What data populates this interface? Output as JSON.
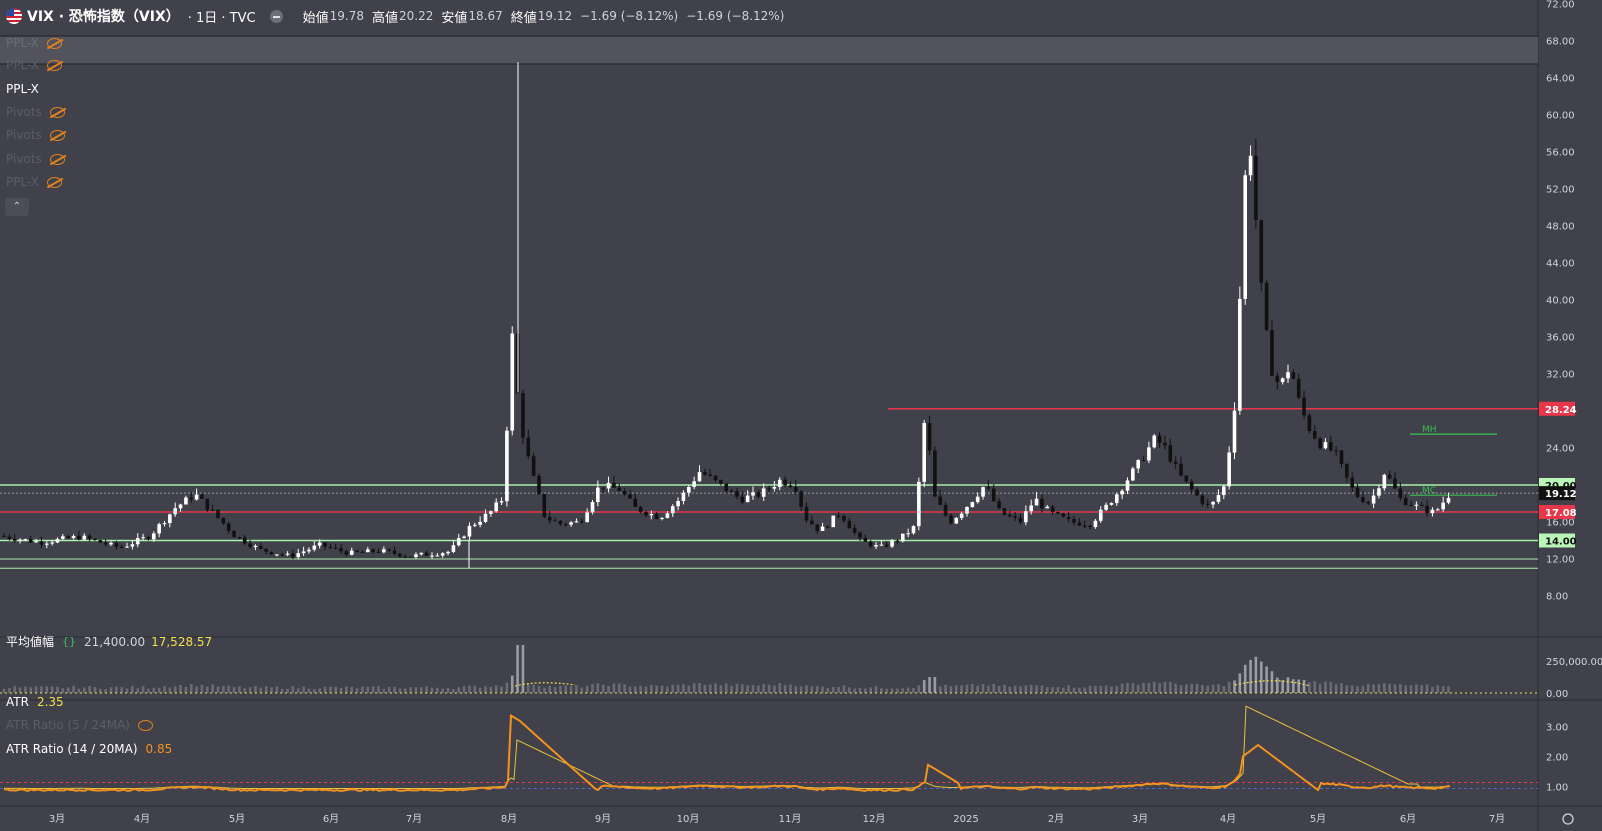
{
  "header": {
    "symbol": "VIX · 恐怖指数（VIX）",
    "interval": "· 1日 · TVC",
    "open_label": "始値",
    "open": "19.78",
    "high_label": "高値",
    "high": "20.22",
    "low_label": "安値",
    "low": "18.67",
    "close_label": "終値",
    "close": "19.12",
    "change1": "−1.69 (−8.12%)",
    "change2": "−1.69 (−8.12%)"
  },
  "legend": {
    "ppl_x_faded": "PPL-X",
    "ppl_x": "PPL-X",
    "pivots1": "Pivots",
    "pivots2": "Pivots",
    "pivots3": "Pivots",
    "ppl_x_bottom": "PPL-X"
  },
  "volume_panel": {
    "title": "平均値幅",
    "value1": "21,400.00",
    "value2": "17,528.57",
    "value2_color": "#f0e04a",
    "axis": [
      "250,000.00",
      "0.00"
    ]
  },
  "atr_panel": {
    "atr_label": "ATR",
    "atr_value": "2.35",
    "ratio_faded_label": "ATR Ratio (5 / 24MA)",
    "ratio_label": "ATR Ratio (14 / 20MA)",
    "ratio_value": "0.85",
    "axis": [
      "3.00",
      "2.00",
      "1.00"
    ]
  },
  "price_axis": [
    "72.00",
    "68.00",
    "64.00",
    "60.00",
    "56.00",
    "52.00",
    "48.00",
    "44.00",
    "40.00",
    "36.00",
    "32.00",
    "28.00",
    "24.00",
    "20.00",
    "16.00",
    "12.00",
    "8.00"
  ],
  "price_badges": [
    {
      "value": 28.24,
      "label": "28.24",
      "bg": "#e8364b",
      "fg": "#ffffff"
    },
    {
      "value": 20.0,
      "label": "20.00",
      "bg": "#b9f5b6",
      "fg": "#111111"
    },
    {
      "value": 19.12,
      "label": "19.12",
      "bg": "#111111",
      "fg": "#ffffff"
    },
    {
      "value": 17.08,
      "label": "17.08",
      "bg": "#e8364b",
      "fg": "#ffffff"
    },
    {
      "value": 14.0,
      "label": "14.00",
      "bg": "#b9f5b6",
      "fg": "#111111"
    }
  ],
  "annotations": {
    "mh": "MH",
    "mc": "MC"
  },
  "time_axis": [
    "3月",
    "4月",
    "5月",
    "6月",
    "7月",
    "8月",
    "9月",
    "10月",
    "11月",
    "12月",
    "2025",
    "2月",
    "3月",
    "4月",
    "5月",
    "6月",
    "7月"
  ],
  "colors": {
    "background": "#40414a",
    "up": "#ffffff",
    "down": "#111111",
    "resistance": "#e8364b",
    "support": "#a8f0a8",
    "atr": "#f2921f",
    "atr_slow": "#e8c43a"
  },
  "chart_data": {
    "type": "candlestick",
    "title": "VIX · 恐怖指数（VIX）",
    "ylim": [
      6,
      72
    ],
    "horizontal_levels": [
      28.24,
      20.0,
      17.08,
      14.0,
      12.0,
      11.0,
      19.12
    ],
    "series": [
      {
        "name": "VIX",
        "points": [
          [
            "3月",
            14.8
          ],
          [
            "3月",
            13.8
          ],
          [
            "4月",
            14.2
          ],
          [
            "4月",
            16.5
          ],
          [
            "4月",
            19.0
          ],
          [
            "5月",
            14.2
          ],
          [
            "5月",
            13.0
          ],
          [
            "6月",
            12.3
          ],
          [
            "6月",
            12.6
          ],
          [
            "7月",
            12.5
          ],
          [
            "7月",
            13.0
          ],
          [
            "8月",
            16.5
          ],
          [
            "8月",
            38.6
          ],
          [
            "8月",
            23.0
          ],
          [
            "8月",
            16.0
          ],
          [
            "9月",
            17.5
          ],
          [
            "9月",
            19.5
          ],
          [
            "10月",
            16.5
          ],
          [
            "10月",
            20.5
          ],
          [
            "10月",
            19.0
          ],
          [
            "11月",
            21.0
          ],
          [
            "11月",
            15.5
          ],
          [
            "12月",
            14.0
          ],
          [
            "12月",
            13.5
          ],
          [
            "12月",
            27.6
          ],
          [
            "2025",
            16.5
          ],
          [
            "2025",
            18.0
          ],
          [
            "2月",
            15.5
          ],
          [
            "2月",
            16.0
          ],
          [
            "3月",
            22.5
          ],
          [
            "3月",
            24.0
          ],
          [
            "3月",
            19.5
          ],
          [
            "4月",
            45.3
          ],
          [
            "4月",
            60.1
          ],
          [
            "4月",
            33.0
          ],
          [
            "5月",
            24.5
          ],
          [
            "5月",
            19.0
          ],
          [
            "6月",
            17.5
          ],
          [
            "6月",
            19.12
          ]
        ]
      }
    ],
    "panels": [
      {
        "name": "平均値幅",
        "values": [
          21400,
          17528.57
        ]
      },
      {
        "name": "ATR",
        "values": [
          2.35
        ]
      },
      {
        "name": "ATR Ratio (14 / 20MA)",
        "values": [
          0.85
        ]
      }
    ]
  }
}
